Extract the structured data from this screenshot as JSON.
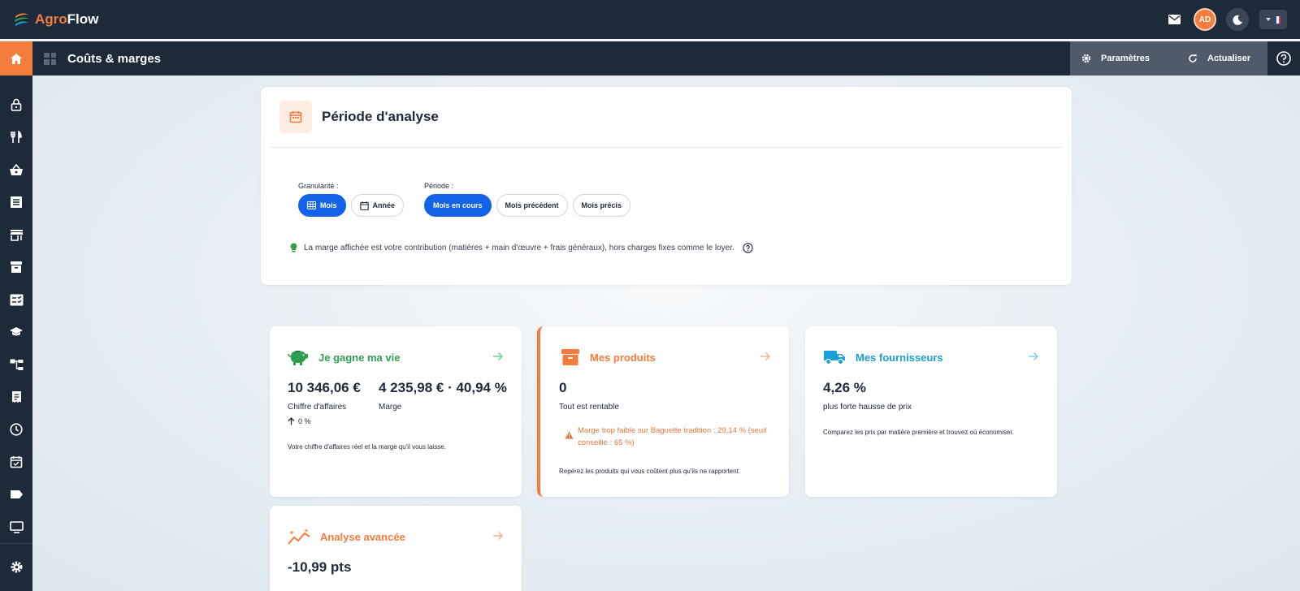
{
  "app": {
    "brand_part1": "Agro",
    "brand_part2": "Flow",
    "avatar_initials": "AD"
  },
  "header": {
    "page_title": "Coûts & marges",
    "settings_label": "Paramètres",
    "refresh_label": "Actualiser"
  },
  "sidebar": {
    "items": [
      "lock-icon",
      "restaurant-icon",
      "basket-icon",
      "list-icon",
      "store-icon",
      "archive-icon",
      "checklist-icon",
      "school-icon",
      "hierarchy-icon",
      "receipt-icon",
      "clock-icon",
      "calendar-check-icon",
      "tag-icon",
      "monitor-icon"
    ],
    "bottom": "settings-icon"
  },
  "period": {
    "title": "Période d'analyse",
    "granularity_label": "Granularité :",
    "granularity_options": [
      "Mois",
      "Année"
    ],
    "granularity_selected": "Mois",
    "period_label": "Période :",
    "period_options": [
      "Mois en cours",
      "Mois précédent",
      "Mois précis"
    ],
    "period_selected": "Mois en cours",
    "note": "La marge affichée est votre contribution (matières + main d'œuvre + frais généraux), hors charges fixes comme le loyer."
  },
  "cards": {
    "livelihood": {
      "title": "Je gagne ma vie",
      "revenue_value": "10 346,06 €",
      "revenue_label": "Chiffre d'affaires",
      "margin_value": "4 235,98 € · 40,94 %",
      "margin_label": "Marge",
      "change": "0 %",
      "footer": "Votre chiffre d'affaires réel et la marge qu'il vous laisse."
    },
    "products": {
      "title": "Mes produits",
      "value": "0",
      "label": "Tout est rentable",
      "warning": "Marge trop faible sur Baguette tradition : 29,14 % (seuil conseillé : 65 %)",
      "footer": "Repérez les produits qui vous coûtent plus qu'ils ne rapportent."
    },
    "suppliers": {
      "title": "Mes fournisseurs",
      "value": "4,26 %",
      "label": "plus forte hausse de prix",
      "footer": "Comparez les prix par matière première et trouvez où économiser."
    },
    "advanced": {
      "title": "Analyse avancée",
      "value": "-10,99 pts"
    }
  },
  "colors": {
    "accent": "#f47c3c",
    "primary": "#1263e8",
    "green": "#2e9e4f",
    "blue": "#1aa0d8",
    "nav": "#1d2a3a"
  }
}
